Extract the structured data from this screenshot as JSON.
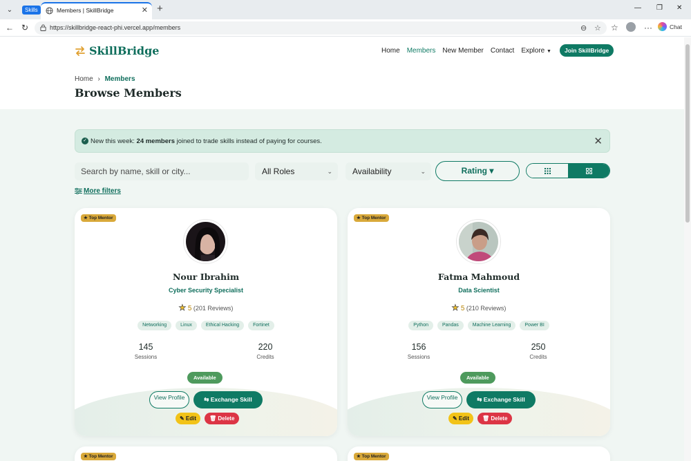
{
  "browser": {
    "group_chip": "Skills",
    "tab_title": "Members | SkillBridge",
    "url": "https://skillbridge-react-phi.vercel.app/members",
    "chat_label": "Chat"
  },
  "navbar": {
    "logo_text": "SkillBridge",
    "links": [
      "Home",
      "Members",
      "New Member",
      "Contact",
      "Explore"
    ],
    "active_link": "Members",
    "join_label": "Join SkillBridge"
  },
  "breadcrumb": {
    "home": "Home",
    "separator": "›",
    "current": "Members"
  },
  "page_title": "Browse Members",
  "banner": {
    "prefix": "New this week: ",
    "highlight": "24 members",
    "suffix": " joined to trade skills instead of paying for courses.",
    "close": "✕"
  },
  "filters": {
    "search_placeholder": "Search by name, skill or city...",
    "roles_label": "All Roles",
    "availability_label": "Availability",
    "rating_label": "Rating ▾",
    "more_filters_label": "More filters"
  },
  "members": [
    {
      "badge": "★ Top Mentor",
      "name": "Nour Ibrahim",
      "role": "Cyber Security Specialist",
      "score": "5",
      "reviews": "(201 Reviews)",
      "skills": [
        "Networking",
        "Linux",
        "Ethical Hacking",
        "Fortinet"
      ],
      "sessions": "145",
      "sessions_label": "Sessions",
      "credits": "220",
      "credits_label": "Credits",
      "status": "Available",
      "view_label": "View Profile",
      "exchange_label": "⇆ Exchange Skill",
      "edit_label": "✎ Edit",
      "delete_label": "🗑 Delete"
    },
    {
      "badge": "★ Top Mentor",
      "name": "Fatma Mahmoud",
      "role": "Data Scientist",
      "score": "5",
      "reviews": "(210 Reviews)",
      "skills": [
        "Python",
        "Pandas",
        "Machine Learning",
        "Power BI"
      ],
      "sessions": "156",
      "sessions_label": "Sessions",
      "credits": "250",
      "credits_label": "Credits",
      "status": "Available",
      "view_label": "View Profile",
      "exchange_label": "⇆ Exchange Skill",
      "edit_label": "✎ Edit",
      "delete_label": "🗑 Delete"
    }
  ],
  "partial_cards": [
    {
      "badge": "★ Top Mentor"
    },
    {
      "badge": "★ Top Mentor"
    }
  ],
  "colors": {
    "brand": "#0f7a64",
    "badge": "#d9a93a",
    "available": "#4e9a5d",
    "delete": "#dc3545",
    "edit": "#f2c318"
  }
}
